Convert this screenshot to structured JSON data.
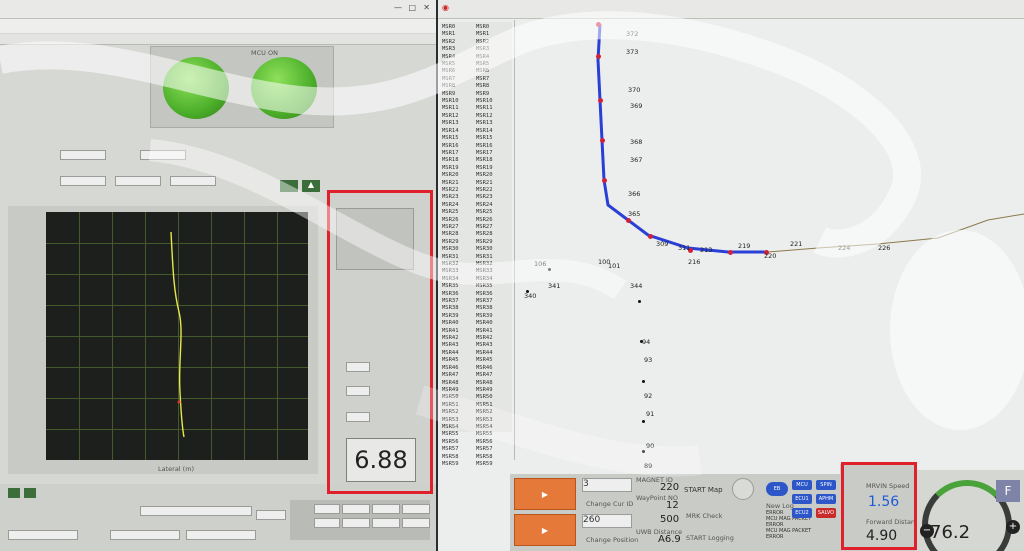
{
  "left_window": {
    "lamp_label": "MCU ON",
    "big_value": "6.88",
    "plot_xlabel": "Lateral (m)"
  },
  "route_window": {
    "list_left": [
      "MSR0",
      "MSR1",
      "MSR2",
      "MSR3",
      "MSR4",
      "MSR5",
      "MSR6",
      "MSR7",
      "MSR8",
      "MSR9",
      "MSR10",
      "MSR11",
      "MSR12",
      "MSR13",
      "MSR14",
      "MSR15",
      "MSR16",
      "MSR17",
      "MSR18",
      "MSR19",
      "MSR20",
      "MSR21",
      "MSR22",
      "MSR23",
      "MSR24",
      "MSR25",
      "MSR26",
      "MSR27",
      "MSR28",
      "MSR29",
      "MSR30",
      "MSR31",
      "MSR32",
      "MSR33",
      "MSR34",
      "MSR35",
      "MSR36",
      "MSR37",
      "MSR38",
      "MSR39",
      "MSR40",
      "MSR41",
      "MSR42",
      "MSR43",
      "MSR44",
      "MSR45",
      "MSR46",
      "MSR47",
      "MSR48",
      "MSR49",
      "MSR50",
      "MSR51",
      "MSR52",
      "MSR53",
      "MSR54",
      "MSR55",
      "MSR56",
      "MSR57",
      "MSR58",
      "MSR59"
    ],
    "list_right": [
      "MSR0",
      "MSR1",
      "MSR2",
      "MSR3",
      "MSR4",
      "MSR5",
      "MSR6",
      "MSR7",
      "MSR8",
      "MSR9",
      "MSR10",
      "MSR11",
      "MSR12",
      "MSR13",
      "MSR14",
      "MSR15",
      "MSR16",
      "MSR17",
      "MSR18",
      "MSR19",
      "MSR20",
      "MSR21",
      "MSR22",
      "MSR23",
      "MSR24",
      "MSR25",
      "MSR26",
      "MSR27",
      "MSR28",
      "MSR29",
      "MSR30",
      "MSR31",
      "MSR32",
      "MSR33",
      "MSR34",
      "MSR35",
      "MSR36",
      "MSR37",
      "MSR38",
      "MSR39",
      "MSR40",
      "MSR41",
      "MSR42",
      "MSR43",
      "MSR44",
      "MSR45",
      "MSR46",
      "MSR47",
      "MSR48",
      "MSR49",
      "MSR50",
      "MSR51",
      "MSR52",
      "MSR53",
      "MSR54",
      "MSR55",
      "MSR56",
      "MSR57",
      "MSR58",
      "MSR59"
    ],
    "route_labels": [
      "372",
      "373",
      "370",
      "369",
      "368",
      "367",
      "366",
      "365",
      "309",
      "311",
      "213",
      "216",
      "219",
      "220",
      "221",
      "224",
      "226",
      "100",
      "101",
      "106",
      "341",
      "340",
      "344",
      "94",
      "93",
      "92",
      "91",
      "90",
      "89"
    ]
  },
  "bottom": {
    "change_cur": "3",
    "change_cur_label": "Change Cur ID",
    "change_pos": "260",
    "change_pos_label": "Change Position",
    "magnet_id_label": "MAGNET ID",
    "magnet_id": "220",
    "waypoint_label": "WayPoint NO",
    "waypoint": "12",
    "uwb_label": "UWB Distance",
    "uwb": "500",
    "other_value": "A6.9",
    "start_map": "START Map",
    "start_logging": "START Logging",
    "mrk_check": "MRK Check",
    "new_log": "New Log",
    "error_lines": [
      "ERROR",
      "MCU MAG PACKET",
      "ERROR",
      "MCU MAG PACKET",
      "ERROR"
    ],
    "eb_label": "EB",
    "buttons": [
      "MCU",
      "SPIN",
      "ECHO",
      "APHM",
      "ECU1",
      "APHM",
      "ECU2",
      "SALVO"
    ],
    "speed_label": "MRVIN Speed",
    "speed_value": "1.56",
    "dist_label": "Forward Distan",
    "dist_value": "4.90",
    "gauge_value": "76.2",
    "f_label": "F"
  },
  "colors": {
    "highlight": "#e0212b",
    "route": "#2a3fd6",
    "route_node": "#d0213a",
    "lamp": "#56c52c"
  }
}
